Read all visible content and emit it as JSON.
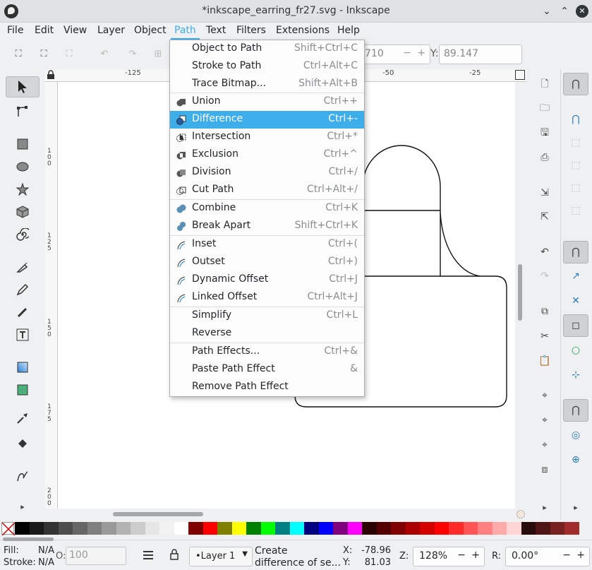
{
  "window": {
    "title": "*inkscape_earring_fr27.svg - Inkscape"
  },
  "menubar": [
    "File",
    "Edit",
    "View",
    "Layer",
    "Object",
    "Path",
    "Text",
    "Filters",
    "Extensions",
    "Help"
  ],
  "active_menu": "Path",
  "toolbar": {
    "x_value": "710",
    "y_label": "Y:",
    "y_value": "89.147",
    "minus": "−",
    "plus": "+"
  },
  "ruler": {
    "h_ticks": [
      "-125",
      "-50",
      "-25"
    ],
    "v_ticks": [
      "100",
      "125",
      "150",
      "175",
      "200"
    ]
  },
  "path_menu": {
    "items": [
      {
        "label": "Object to Path",
        "shortcut": "Shift+Ctrl+C",
        "icon": ""
      },
      {
        "label": "Stroke to Path",
        "shortcut": "Ctrl+Alt+C",
        "icon": ""
      },
      {
        "label": "Trace Bitmap...",
        "shortcut": "Shift+Alt+B",
        "icon": ""
      },
      {
        "label": "Union",
        "shortcut": "Ctrl++",
        "icon": "union-icon"
      },
      {
        "label": "Difference",
        "shortcut": "Ctrl+-",
        "icon": "difference-icon",
        "highlighted": true
      },
      {
        "label": "Intersection",
        "shortcut": "Ctrl+*",
        "icon": "intersection-icon"
      },
      {
        "label": "Exclusion",
        "shortcut": "Ctrl+^",
        "icon": "exclusion-icon"
      },
      {
        "label": "Division",
        "shortcut": "Ctrl+/",
        "icon": "division-icon"
      },
      {
        "label": "Cut Path",
        "shortcut": "Ctrl+Alt+/",
        "icon": "cut-path-icon"
      },
      {
        "label": "Combine",
        "shortcut": "Ctrl+K",
        "icon": "combine-icon"
      },
      {
        "label": "Break Apart",
        "shortcut": "Shift+Ctrl+K",
        "icon": "break-apart-icon"
      },
      {
        "label": "Inset",
        "shortcut": "Ctrl+(",
        "icon": "inset-icon"
      },
      {
        "label": "Outset",
        "shortcut": "Ctrl+)",
        "icon": "outset-icon"
      },
      {
        "label": "Dynamic Offset",
        "shortcut": "Ctrl+J",
        "icon": "dynamic-offset-icon"
      },
      {
        "label": "Linked Offset",
        "shortcut": "Ctrl+Alt+J",
        "icon": "linked-offset-icon"
      },
      {
        "label": "Simplify",
        "shortcut": "Ctrl+L",
        "icon": ""
      },
      {
        "label": "Reverse",
        "shortcut": "",
        "icon": ""
      },
      {
        "label": "Path Effects...",
        "shortcut": "Ctrl+&",
        "icon": ""
      },
      {
        "label": "Paste Path Effect",
        "shortcut": "&",
        "icon": ""
      },
      {
        "label": "Remove Path Effect",
        "shortcut": "",
        "icon": ""
      }
    ]
  },
  "palette": [
    "#000000",
    "#1a1a1a",
    "#333333",
    "#4d4d4d",
    "#666666",
    "#808080",
    "#999999",
    "#b3b3b3",
    "#cccccc",
    "#e6e6e6",
    "#f2f2f2",
    "#ffffff",
    "#800000",
    "#ff0000",
    "#808000",
    "#ffff00",
    "#008000",
    "#00ff00",
    "#008080",
    "#00ffff",
    "#000080",
    "#0000ff",
    "#800080",
    "#ff00ff",
    "#2b0000",
    "#550000",
    "#800000",
    "#aa0000",
    "#d40000",
    "#ff0000",
    "#ff2a2a",
    "#ff5555",
    "#ff8080",
    "#ffaaaa",
    "#ffd5d5",
    "#280b0b",
    "#501616",
    "#782121",
    "#a02c2c"
  ],
  "status": {
    "fill_label": "Fill:",
    "fill_value": "N/A",
    "stroke_label": "Stroke:",
    "stroke_value": "N/A",
    "opacity_label": "O:",
    "opacity_value": "100",
    "layer": "•Layer 1",
    "message_line1": "Create",
    "message_line2": "difference of se...",
    "x_label": "X:",
    "x_value": "-78.96",
    "y_label": "Y:",
    "y_value": "81.03",
    "z_label": "Z:",
    "zoom": "128%",
    "r_label": "R:",
    "rotation": "0.00°"
  }
}
